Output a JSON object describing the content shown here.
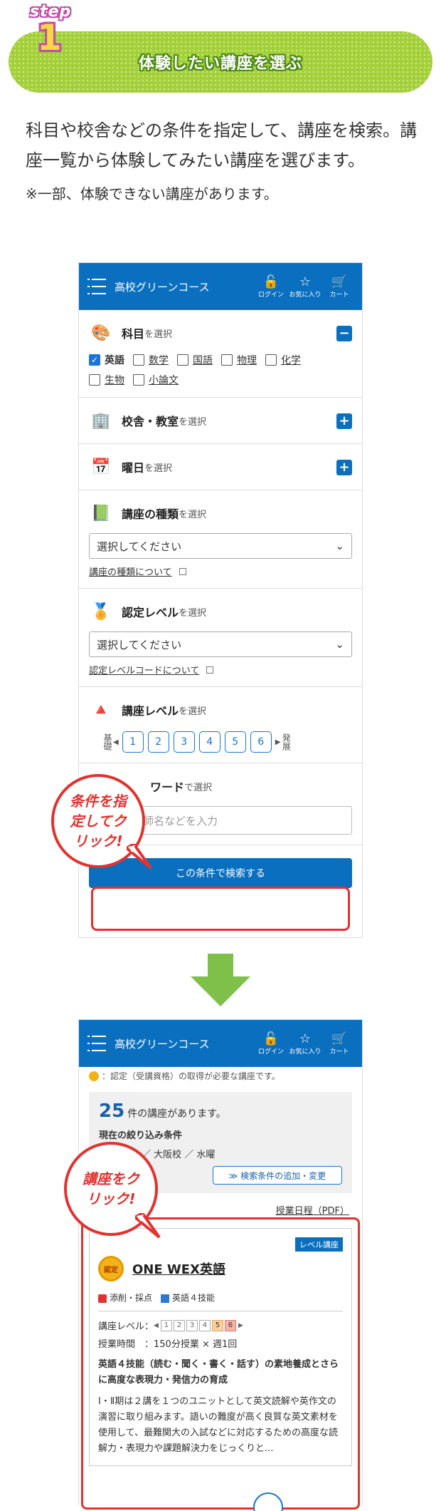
{
  "step": {
    "word": "step",
    "number": "1",
    "title": "体験したい講座を選ぶ"
  },
  "intro": {
    "text": "科目や校舎などの条件を指定して、講座を検索。講座一覧から体験してみたい講座を選びます。",
    "note": "※一部、体験できない講座があります。"
  },
  "app": {
    "title": "高校グリーンコース",
    "icons": [
      {
        "name": "lock-icon",
        "glyph": "🔓",
        "label": "ログイン"
      },
      {
        "name": "star-icon",
        "glyph": "☆",
        "label": "お気に入り"
      },
      {
        "name": "cart-icon",
        "glyph": "🛒",
        "label": "カート"
      }
    ]
  },
  "form": {
    "subject": {
      "title": "科目",
      "suffix": "を選択",
      "toggle": "−",
      "options": [
        {
          "label": "英語",
          "checked": true
        },
        {
          "label": "数学",
          "checked": false
        },
        {
          "label": "国語",
          "checked": false
        },
        {
          "label": "物理",
          "checked": false
        },
        {
          "label": "化学",
          "checked": false
        },
        {
          "label": "生物",
          "checked": false
        },
        {
          "label": "小論文",
          "checked": false
        }
      ]
    },
    "campus": {
      "title": "校舎・教室",
      "suffix": "を選択",
      "toggle": "+"
    },
    "weekday": {
      "title": "曜日",
      "suffix": "を選択",
      "toggle": "+"
    },
    "type": {
      "title": "講座の種類",
      "suffix": "を選択",
      "select": "選択してください",
      "link": "講座の種類について"
    },
    "cert": {
      "title": "認定レベル",
      "suffix": "を選択",
      "select": "選択してください",
      "link": "認定レベルコードについて"
    },
    "level": {
      "title": "講座レベル",
      "suffix": "を選択",
      "low": "基礎",
      "high": "発展",
      "values": [
        "1",
        "2",
        "3",
        "4",
        "5",
        "6"
      ]
    },
    "keyword": {
      "title": "ワード",
      "suffix": "で選択",
      "placeholder": "講師名などを入力"
    },
    "search_button": "この条件で検索する"
  },
  "callouts": {
    "first": "条件を指定してクリック!",
    "second": "講座をクリック!"
  },
  "results": {
    "note": "：認定（受講資格）の取得が必要な講座です。",
    "count": "25",
    "count_text": "件の講座があります。",
    "filter_title": "現在の絞り込み条件",
    "filter_value": "／ 大阪校 ／ 水曜",
    "add_button": "≫ 検索条件の追加・変更",
    "pdf_link": "授業日程（PDF）",
    "course": {
      "tag": "レベル講座",
      "badge": "認定",
      "title": "ONE WEX英語",
      "attr1": "添削・採点",
      "attr2": "英語４技能",
      "level_label": "講座レベル：",
      "levels": [
        "1",
        "2",
        "3",
        "4",
        "5",
        "6"
      ],
      "lesson": "授業時間　：150分授業 × 週1回",
      "heading": "英語４技能（読む・聞く・書く・話す）の素地養成とさらに高度な表現力・発信力の育成",
      "description": "Ⅰ・Ⅱ期は２講を１つのユニットとして英文読解や英作文の演習に取り組みます。語いの難度が高く良質な英文素材を使用して、最難関大の入試などに対応するための高度な読解力・表現力や課題解決力をじっくりと..."
    }
  },
  "colors": {
    "brand": "#0b6fbf",
    "accent_green": "#a3cf3a",
    "callout_red": "#e2322f"
  }
}
